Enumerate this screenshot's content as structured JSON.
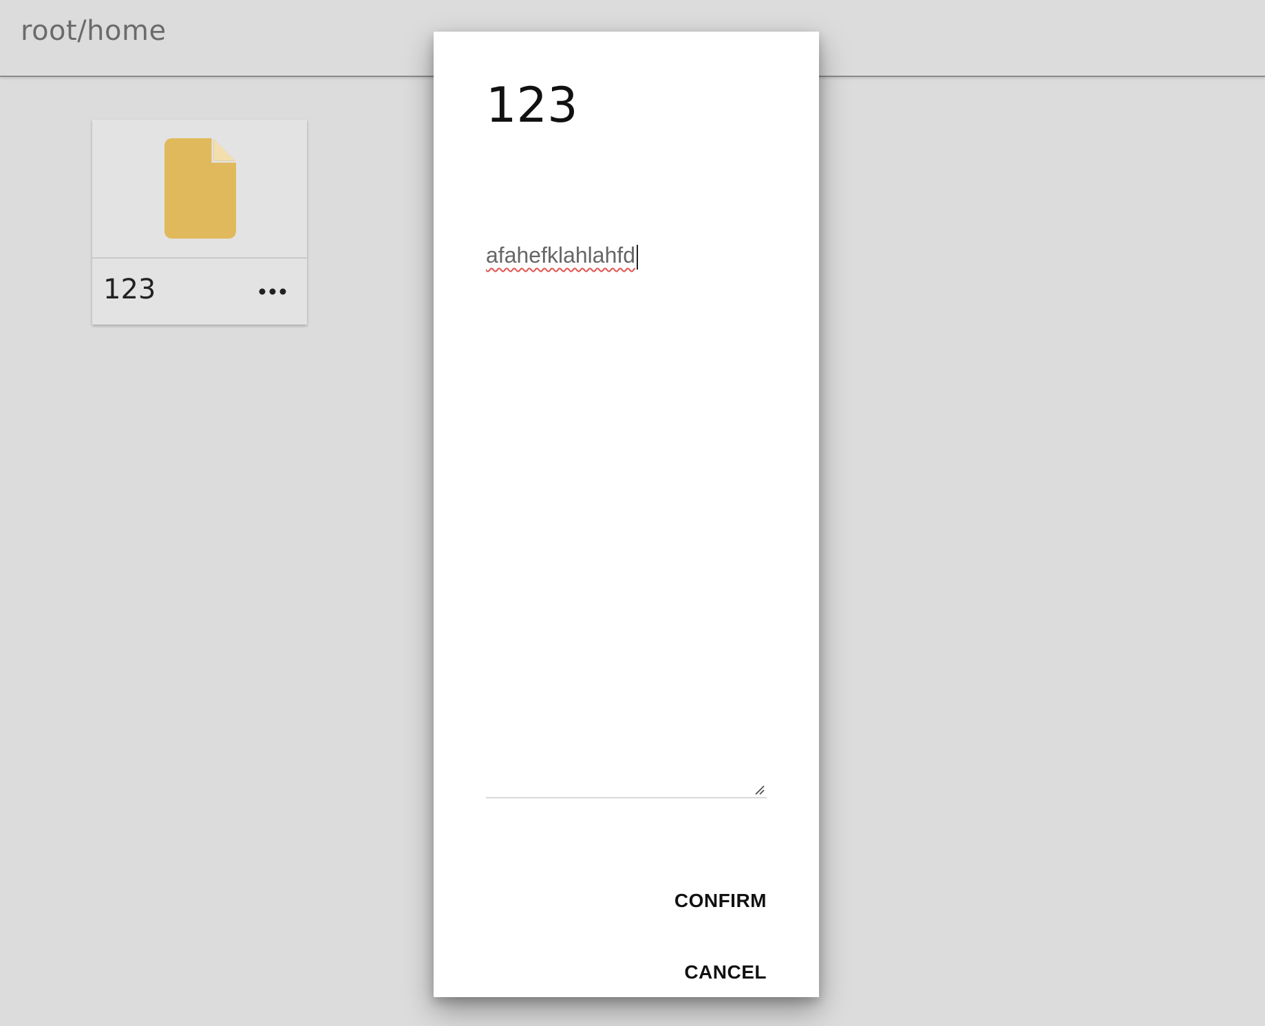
{
  "header": {
    "breadcrumb": "root/home"
  },
  "files": [
    {
      "name": "123",
      "icon": "document-icon",
      "icon_color": "#e0b95c",
      "menu_icon": "more-horizontal-icon"
    }
  ],
  "dialog": {
    "title": "123",
    "textarea_value": "afahefklahlahfd",
    "confirm_label": "CONFIRM",
    "cancel_label": "CANCEL"
  },
  "colors": {
    "background": "#dcdcdc",
    "dialog_background": "#ffffff",
    "spellcheck_underline": "#e0534c"
  }
}
